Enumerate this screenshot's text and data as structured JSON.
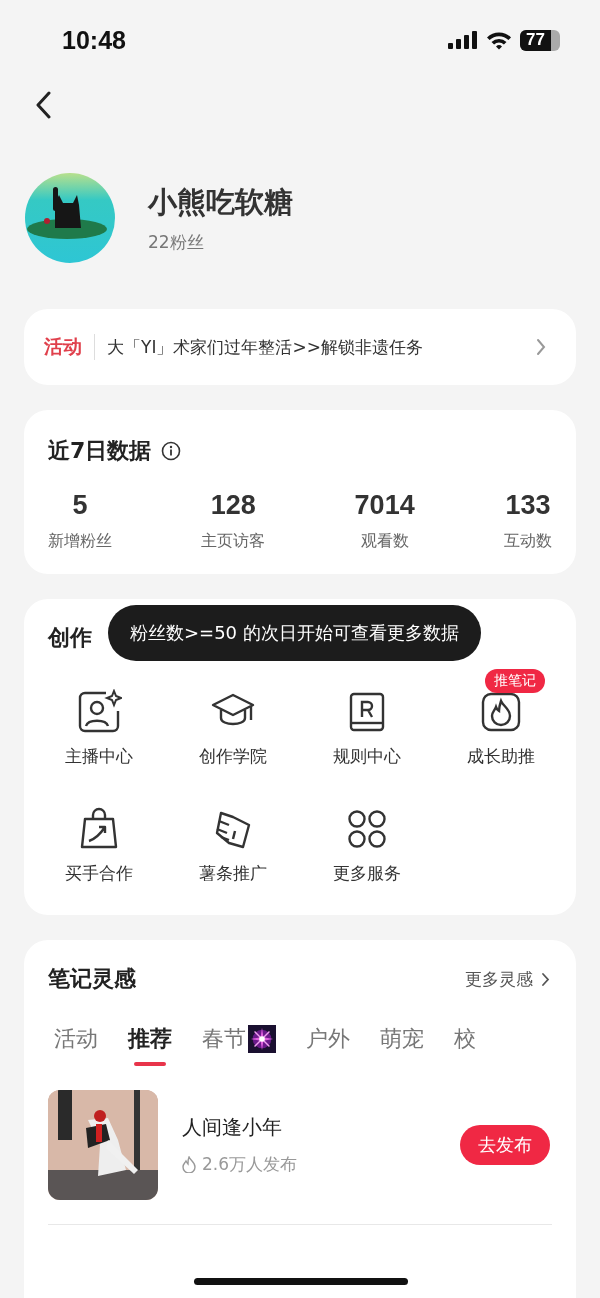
{
  "status_bar": {
    "time": "10:48",
    "battery": "77"
  },
  "profile": {
    "name": "小熊吃软糖",
    "followers": "22粉丝"
  },
  "activity_banner": {
    "tag": "活动",
    "text": "大「YI」术家们过年整活>>解锁非遗任务"
  },
  "stats": {
    "title": "近7日数据",
    "items": [
      {
        "value": "5",
        "label": "新增粉丝"
      },
      {
        "value": "128",
        "label": "主页访客"
      },
      {
        "value": "7014",
        "label": "观看数"
      },
      {
        "value": "133",
        "label": "互动数"
      }
    ]
  },
  "services": {
    "title": "创作",
    "tooltip": "粉丝数>=50 的次日开始可查看更多数据",
    "items": [
      {
        "kind": "host",
        "label": "主播中心"
      },
      {
        "kind": "academy",
        "label": "创作学院"
      },
      {
        "kind": "rules",
        "label": "规则中心"
      },
      {
        "kind": "growth",
        "label": "成长助推",
        "badge": "推笔记"
      },
      {
        "kind": "buyer",
        "label": "买手合作"
      },
      {
        "kind": "promo",
        "label": "薯条推广"
      },
      {
        "kind": "more",
        "label": "更多服务"
      }
    ]
  },
  "inspiration": {
    "title": "笔记灵感",
    "more_link": "更多灵感",
    "tabs": [
      {
        "label": "活动",
        "selected": false,
        "kind": "text"
      },
      {
        "label": "推荐",
        "selected": true,
        "kind": "text"
      },
      {
        "label": "春节",
        "selected": false,
        "kind": "picture"
      },
      {
        "label": "户外",
        "selected": false,
        "kind": "text"
      },
      {
        "label": "萌宠",
        "selected": false,
        "kind": "text"
      },
      {
        "label": "校",
        "selected": false,
        "kind": "text"
      }
    ],
    "topics": [
      {
        "title": "人间逢小年",
        "count": "2.6万人发布",
        "action": "去发布"
      }
    ]
  }
}
